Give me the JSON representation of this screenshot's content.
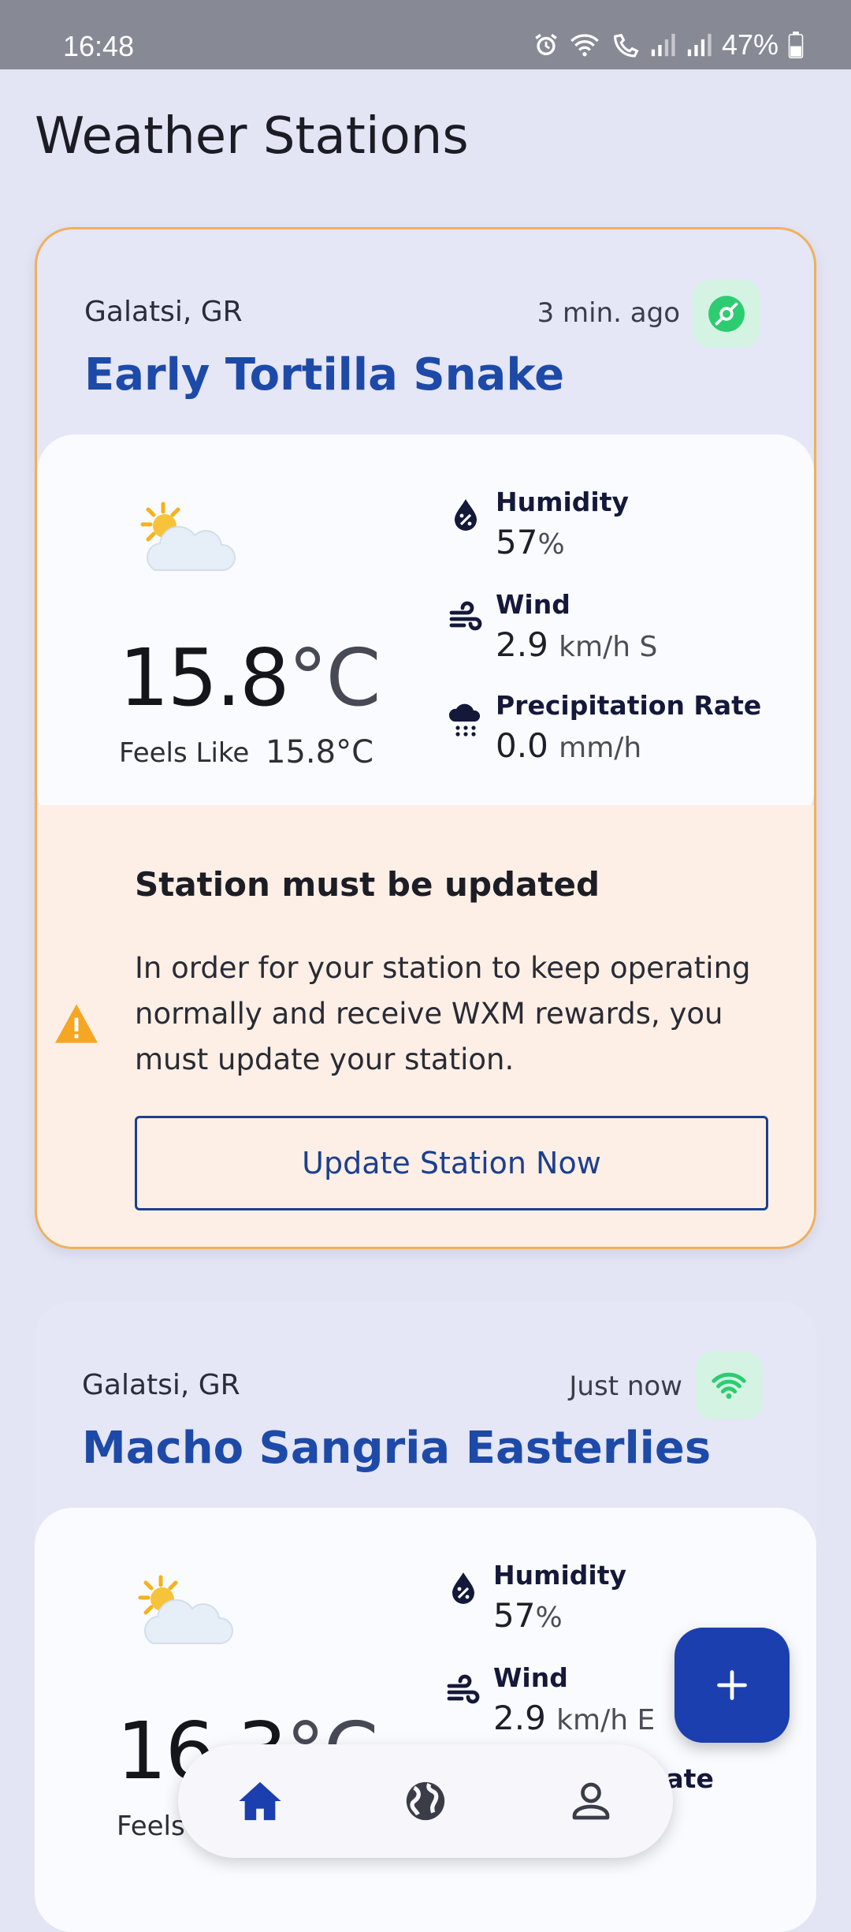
{
  "status_bar": {
    "time": "16:48",
    "battery": "47%"
  },
  "page": {
    "title": "Weather Stations"
  },
  "stations": [
    {
      "location": "Galatsi, GR",
      "last_seen": "3 min. ago",
      "status_icon": "helium-hotspot-icon",
      "name": "Early Tortilla Snake",
      "weather_icon": "partly-cloudy-icon",
      "temperature": "15.8",
      "temperature_unit": "°C",
      "feels_like_label": "Feels Like",
      "feels_like_value": "15.8°C",
      "humidity_label": "Humidity",
      "humidity_value": "57",
      "humidity_unit": "%",
      "wind_label": "Wind",
      "wind_value": "2.9",
      "wind_unit": "km/h S",
      "precip_label": "Precipitation Rate",
      "precip_value": "0.0",
      "precip_unit": "mm/h",
      "alert": {
        "title": "Station must be updated",
        "body": "In order for your station to keep operating normally and receive WXM rewards, you must update your station.",
        "button": "Update Station Now"
      }
    },
    {
      "location": "Galatsi, GR",
      "last_seen": "Just now",
      "status_icon": "wifi-icon",
      "name": "Macho Sangria Easterlies",
      "weather_icon": "partly-cloudy-icon",
      "temperature": "16.3",
      "temperature_unit": "°C",
      "feels_like_label": "Feels",
      "humidity_label": "Humidity",
      "humidity_value": "57",
      "humidity_unit": "%",
      "wind_label": "Wind",
      "wind_value": "2.9",
      "wind_unit": "km/h E",
      "precip_label": "Rate"
    }
  ],
  "bottom_nav": [
    "home-icon",
    "globe-icon",
    "profile-icon"
  ],
  "fab": {
    "icon": "plus-icon"
  },
  "colors": {
    "accent": "#1b3fae",
    "name": "#1d4aa8",
    "online": "#2ecc71",
    "warning": "#f5a623",
    "alert_bg": "#fdefe6"
  }
}
